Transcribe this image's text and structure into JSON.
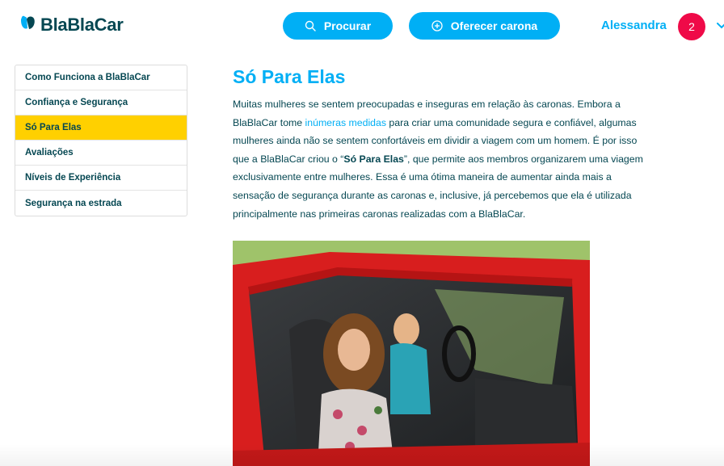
{
  "header": {
    "logo_text": "BlaBlaCar",
    "search_label": "Procurar",
    "offer_label": "Oferecer carona",
    "user_name": "Alessandra",
    "notification_count": "2"
  },
  "sidebar": {
    "items": [
      {
        "label": "Como Funciona a BlaBlaCar",
        "active": false
      },
      {
        "label": "Confiança e Segurança",
        "active": false
      },
      {
        "label": "Só Para Elas",
        "active": true
      },
      {
        "label": "Avaliações",
        "active": false
      },
      {
        "label": "Níveis de Experiência",
        "active": false
      },
      {
        "label": "Segurança na estrada",
        "active": false
      }
    ]
  },
  "article": {
    "title": "Só Para Elas",
    "p_part1": "Muitas mulheres se sentem preocupadas e inseguras em relação às caronas. Embora a BlaBlaCar tome ",
    "p_link": "inúmeras medidas",
    "p_part2": " para criar uma comunidade segura e confiável, algumas mulheres ainda não se sentem confortáveis em dividir a viagem com um homem. É por isso que a BlaBlaCar criou o “",
    "p_bold": "Só Para Elas",
    "p_part3": "”, que permite aos membros organizarem uma viagem exclusivamente entre mulheres. Essa é uma ótima maneira de aumentar ainda mais a sensação de segurança durante as caronas e, inclusive, já percebemos que ela é utilizada principalmente nas primeiras caronas realizadas com a BlaBlaCar."
  },
  "icons": {
    "logo": "blablacar-logo-icon",
    "search": "search-icon",
    "offer": "plus-circle-icon",
    "menu": "chevron-down-icon"
  },
  "colors": {
    "brand_blue": "#00aff5",
    "dark_teal": "#054752",
    "active_yellow": "#ffd000",
    "badge_red": "#ef0a48"
  }
}
